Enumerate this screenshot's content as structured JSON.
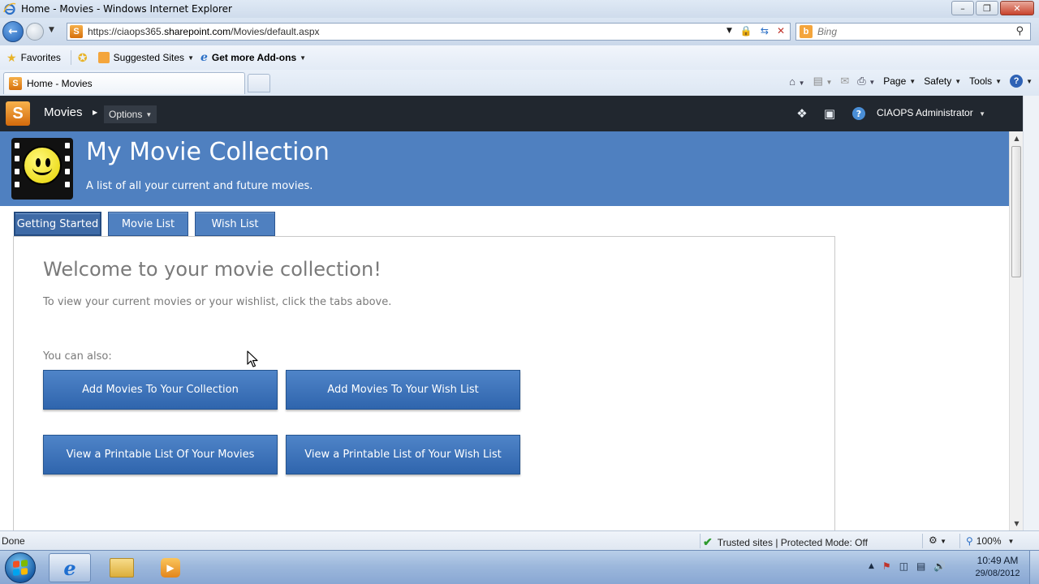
{
  "browser": {
    "window_title": "Home - Movies - Windows Internet Explorer",
    "url_prefix": "https://ciaops365.",
    "url_host": "sharepoint.com",
    "url_path": "/Movies/default.aspx",
    "search_placeholder": "Bing",
    "favorites_label": "Favorites",
    "suggested_sites_label": "Suggested Sites",
    "addons_label": "Get more Add-ons",
    "tab_title": "Home - Movies",
    "commands": {
      "page": "Page",
      "safety": "Safety",
      "tools": "Tools"
    }
  },
  "sharepoint_bar": {
    "site_name": "Movies",
    "options_label": "Options",
    "user_name": "CIAOPS Administrator"
  },
  "site": {
    "title": "My Movie Collection",
    "description": "A list of all your current and future movies."
  },
  "tabs": [
    {
      "label": "Getting Started",
      "active": true
    },
    {
      "label": "Movie List",
      "active": false
    },
    {
      "label": "Wish List",
      "active": false
    }
  ],
  "content": {
    "heading": "Welcome to your movie collection!",
    "intro": "To view your current movies or your wishlist, click the tabs above.",
    "also_label": "You can also:",
    "buttons": [
      "Add Movies To Your Collection",
      "Add Movies To Your Wish List",
      "View a Printable List Of Your Movies",
      "View a Printable List of Your Wish List"
    ]
  },
  "status": {
    "left": "Done",
    "zone": "Trusted sites | Protected Mode: Off",
    "zoom": "100%"
  },
  "taskbar": {
    "time": "10:49 AM",
    "date": "29/08/2012"
  },
  "colors": {
    "header_blue": "#4f80c0",
    "ribbon_dark": "#21272f",
    "button_blue": "#3a72bd"
  }
}
